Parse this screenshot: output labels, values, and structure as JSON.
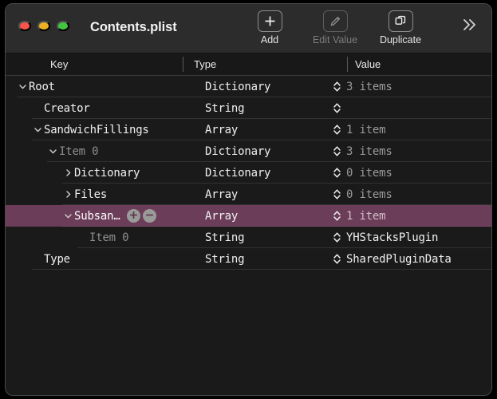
{
  "window": {
    "title": "Contents.plist",
    "traffic_lights": [
      {
        "name": "close",
        "color": "#f8544b"
      },
      {
        "name": "minimize",
        "color": "#ecb122"
      },
      {
        "name": "zoom",
        "color": "#41c63f"
      }
    ]
  },
  "toolbar": {
    "items": [
      {
        "label": "Add",
        "icon": "plus-icon",
        "enabled": true
      },
      {
        "label": "Edit Value",
        "icon": "pencil-icon",
        "enabled": false
      },
      {
        "label": "Duplicate",
        "icon": "duplicate-icon",
        "enabled": true
      }
    ],
    "overflow_icon": "double-chevron-right-icon"
  },
  "table": {
    "columns": [
      "Key",
      "Type",
      "Value"
    ],
    "rows": [
      {
        "key": "Root",
        "type": "Dictionary",
        "value": "3 items",
        "indent": 0,
        "twisty": "down",
        "dim_key": false,
        "dim_value": true,
        "selected": false,
        "has_buttons": false
      },
      {
        "key": "Creator",
        "type": "String",
        "value": "",
        "indent": 1,
        "twisty": "none",
        "dim_key": false,
        "dim_value": true,
        "selected": false,
        "has_buttons": false
      },
      {
        "key": "SandwichFillings",
        "type": "Array",
        "value": "1 item",
        "indent": 1,
        "twisty": "down",
        "dim_key": false,
        "dim_value": true,
        "selected": false,
        "has_buttons": false
      },
      {
        "key": "Item 0",
        "type": "Dictionary",
        "value": "3 items",
        "indent": 2,
        "twisty": "down",
        "dim_key": true,
        "dim_value": true,
        "selected": false,
        "has_buttons": false
      },
      {
        "key": "Dictionary",
        "type": "Dictionary",
        "value": "0 items",
        "indent": 3,
        "twisty": "right",
        "dim_key": false,
        "dim_value": true,
        "selected": false,
        "has_buttons": false
      },
      {
        "key": "Files",
        "type": "Array",
        "value": "0 items",
        "indent": 3,
        "twisty": "right",
        "dim_key": false,
        "dim_value": true,
        "selected": false,
        "has_buttons": false
      },
      {
        "key": "Subsan…",
        "type": "Array",
        "value": "1 item",
        "indent": 3,
        "twisty": "down",
        "dim_key": false,
        "dim_value": true,
        "selected": true,
        "has_buttons": true
      },
      {
        "key": "Item 0",
        "type": "String",
        "value": "YHStacksPlugin",
        "indent": 4,
        "twisty": "none",
        "dim_key": true,
        "dim_value": false,
        "selected": false,
        "has_buttons": false
      },
      {
        "key": "Type",
        "type": "String",
        "value": "SharedPluginData",
        "indent": 1,
        "twisty": "none",
        "dim_key": false,
        "dim_value": false,
        "selected": false,
        "has_buttons": false
      }
    ],
    "row_buttons": [
      {
        "name": "add-row-button",
        "glyph": "plus-circle-icon"
      },
      {
        "name": "remove-row-button",
        "glyph": "minus-circle-icon"
      }
    ]
  },
  "colors": {
    "selection": "#6b3d58",
    "window_bg": "#1e1e1e",
    "titlebar_bg": "#2c2c2c",
    "list_bg": "#1a1a1a"
  }
}
